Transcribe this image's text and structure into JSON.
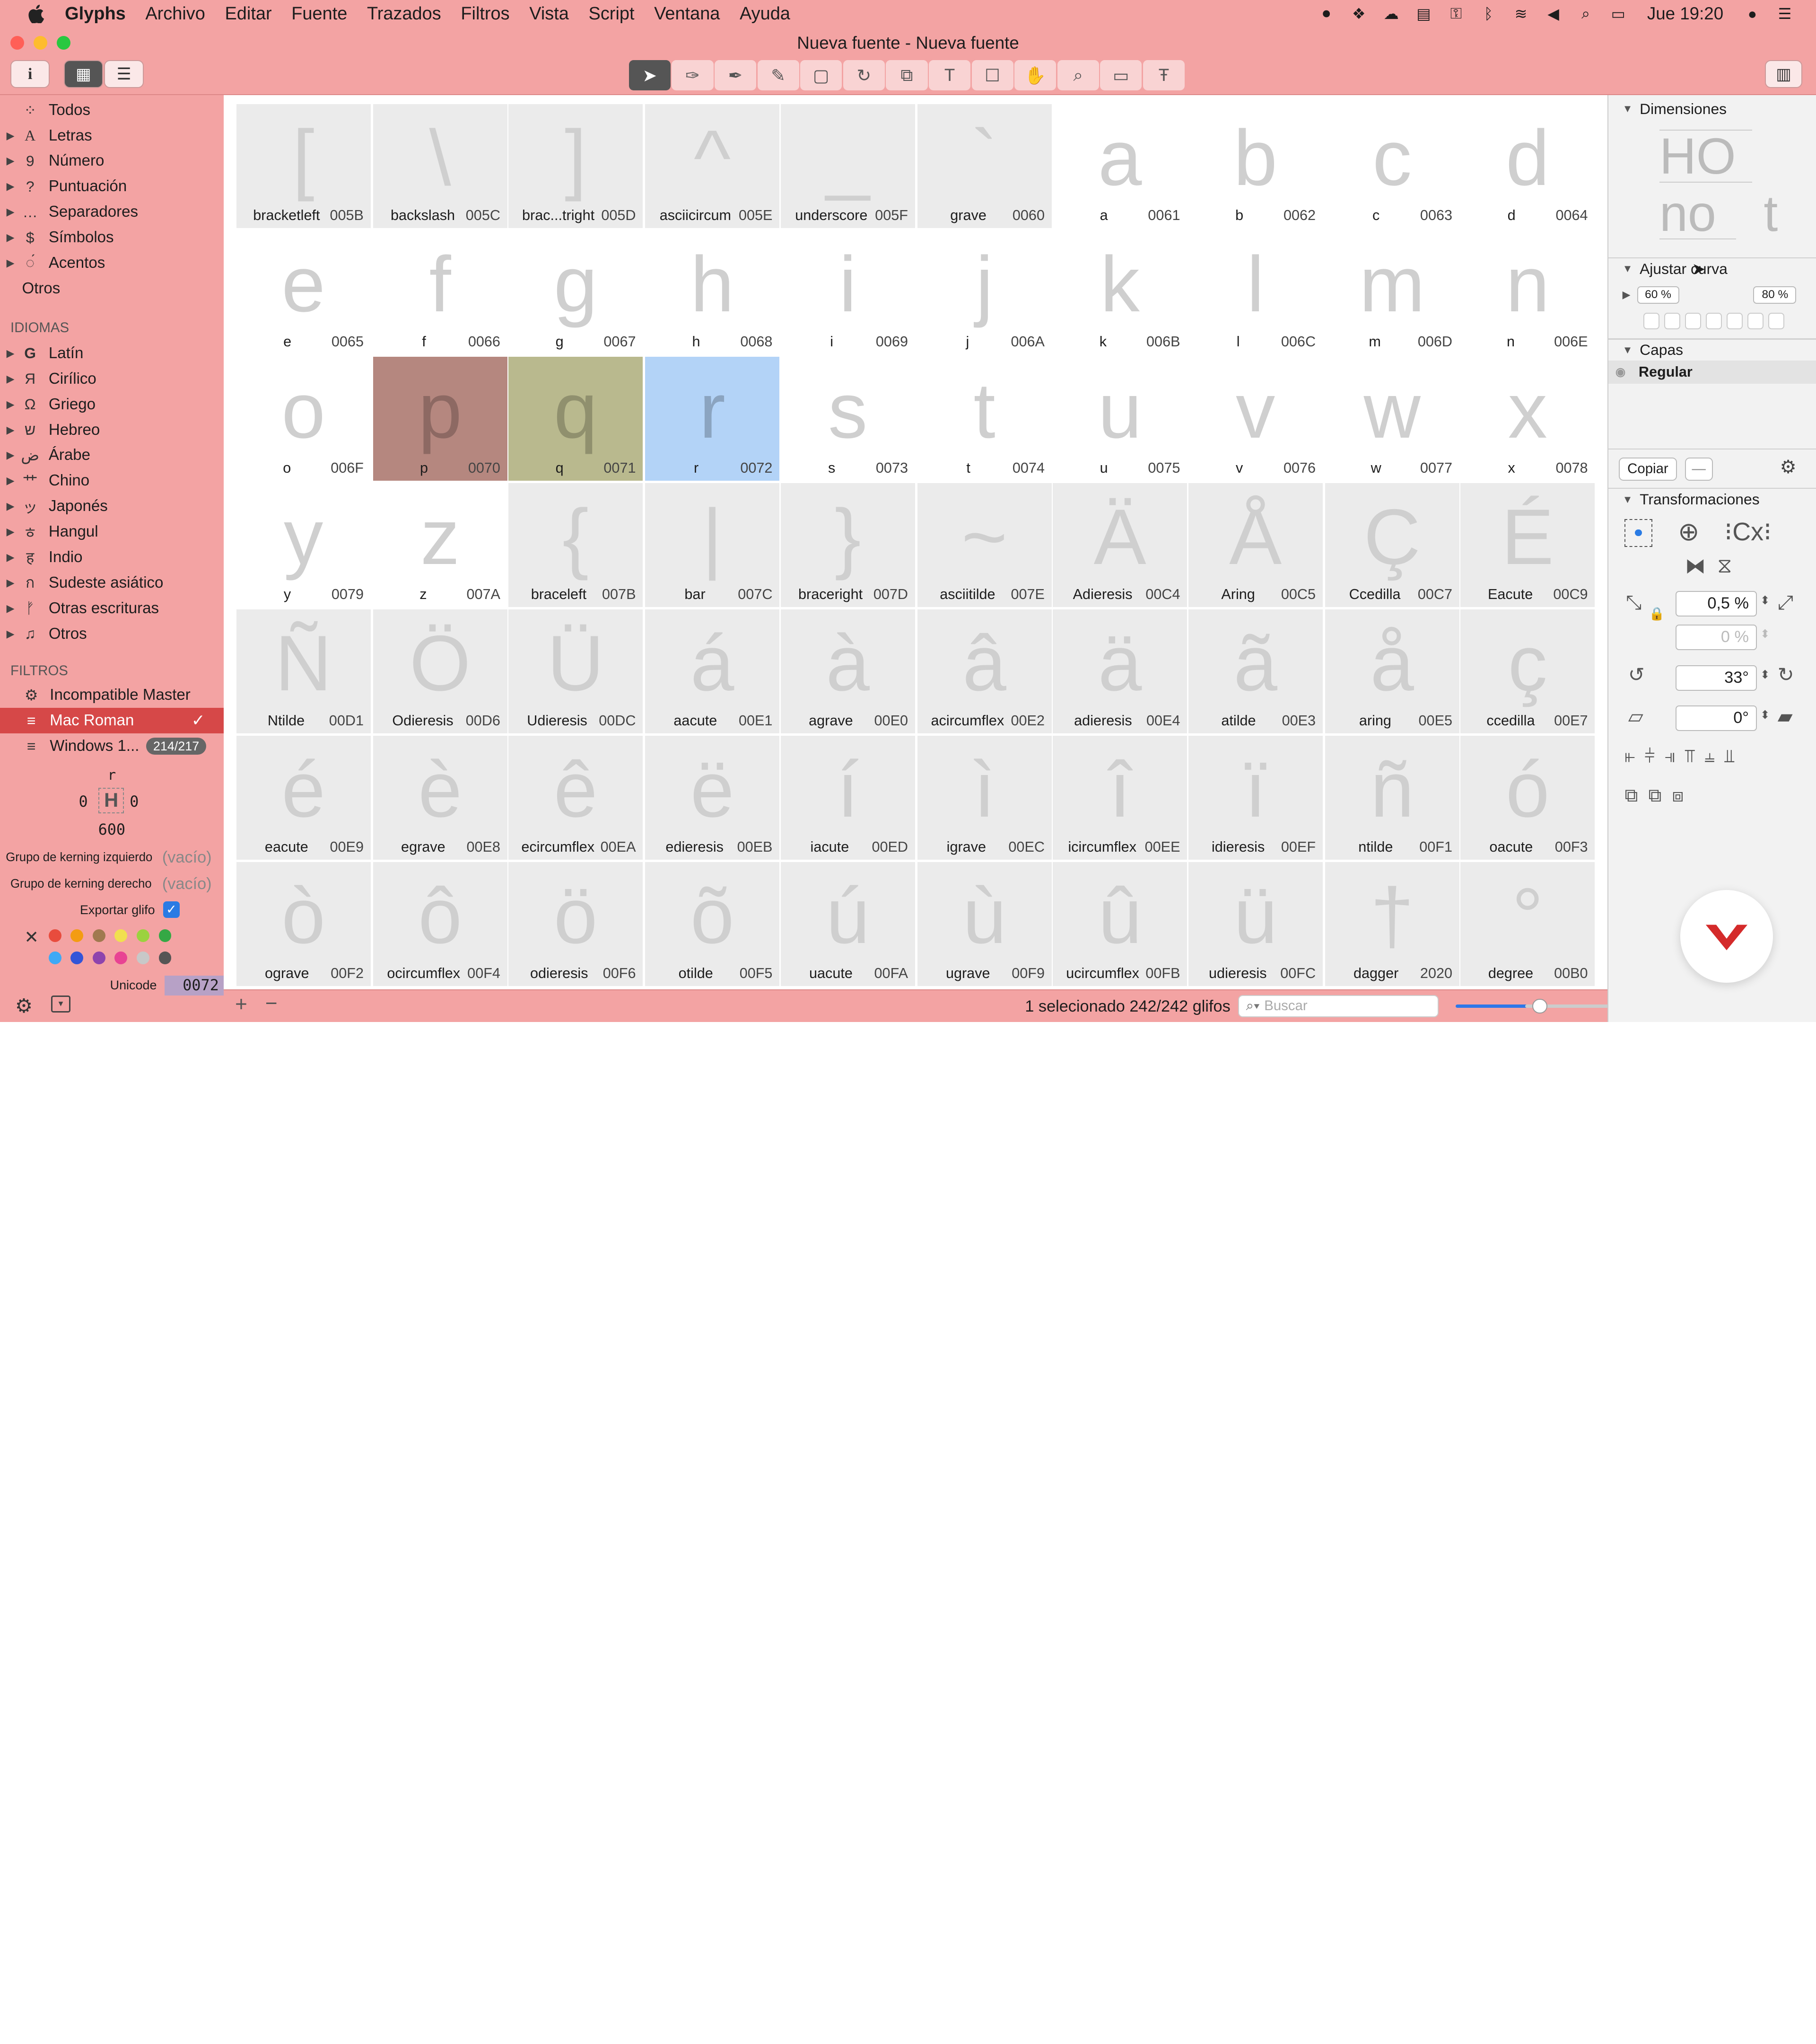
{
  "menubar": {
    "app": "Glyphs",
    "items": [
      "Archivo",
      "Editar",
      "Fuente",
      "Trazados",
      "Filtros",
      "Vista",
      "Script",
      "Ventana",
      "Ayuda"
    ],
    "clock": "Jue 19:20"
  },
  "window": {
    "title": "Nueva fuente - Nueva fuente"
  },
  "sidebar": {
    "categories": [
      {
        "label": "Todos",
        "icon": "grid-icon"
      },
      {
        "label": "Letras",
        "icon": "letter-icon"
      },
      {
        "label": "Número",
        "icon": "number-icon"
      },
      {
        "label": "Puntuación",
        "icon": "question-icon"
      },
      {
        "label": "Separadores",
        "icon": "dots-icon"
      },
      {
        "label": "Símbolos",
        "icon": "dollar-icon"
      },
      {
        "label": "Acentos",
        "icon": "accent-icon"
      },
      {
        "label": "Otros",
        "icon": ""
      }
    ],
    "idiomas_header": "IDIOMAS",
    "languages": [
      "Latín",
      "Cirílico",
      "Griego",
      "Hebreo",
      "Árabe",
      "Chino",
      "Japonés",
      "Hangul",
      "Indio",
      "Sudeste asiático",
      "Otras escrituras",
      "Otros"
    ],
    "filtros_header": "FILTROS",
    "filters": [
      {
        "label": "Incompatible Master"
      },
      {
        "label": "Mac Roman",
        "selected": true
      },
      {
        "label": "Windows 1...",
        "badge": "214/217"
      }
    ],
    "glyph_info": {
      "name": "r",
      "lsb": "0",
      "rsb": "0",
      "width": "600"
    },
    "kern_left_label": "Grupo de kerning izquierdo",
    "kern_left_value": "(vacío)",
    "kern_right_label": "Grupo de kerning derecho",
    "kern_right_value": "(vacío)",
    "export_label": "Exportar glifo",
    "unicode_label": "Unicode",
    "unicode_value": "0072"
  },
  "glyphs": [
    {
      "ch": "[",
      "name": "bracketleft",
      "code": "005B",
      "bg": true
    },
    {
      "ch": "\\",
      "name": "backslash",
      "code": "005C",
      "bg": true
    },
    {
      "ch": "]",
      "name": "brac...tright",
      "code": "005D",
      "bg": true
    },
    {
      "ch": "^",
      "name": "asciicircum",
      "code": "005E",
      "bg": true
    },
    {
      "ch": "_",
      "name": "underscore",
      "code": "005F",
      "bg": true
    },
    {
      "ch": "`",
      "name": "grave",
      "code": "0060",
      "bg": true
    },
    {
      "ch": "a",
      "name": "a",
      "code": "0061"
    },
    {
      "ch": "b",
      "name": "b",
      "code": "0062"
    },
    {
      "ch": "c",
      "name": "c",
      "code": "0063"
    },
    {
      "ch": "d",
      "name": "d",
      "code": "0064"
    },
    {
      "ch": "e",
      "name": "e",
      "code": "0065"
    },
    {
      "ch": "f",
      "name": "f",
      "code": "0066"
    },
    {
      "ch": "g",
      "name": "g",
      "code": "0067"
    },
    {
      "ch": "h",
      "name": "h",
      "code": "0068"
    },
    {
      "ch": "i",
      "name": "i",
      "code": "0069"
    },
    {
      "ch": "j",
      "name": "j",
      "code": "006A"
    },
    {
      "ch": "k",
      "name": "k",
      "code": "006B"
    },
    {
      "ch": "l",
      "name": "l",
      "code": "006C"
    },
    {
      "ch": "m",
      "name": "m",
      "code": "006D"
    },
    {
      "ch": "n",
      "name": "n",
      "code": "006E"
    },
    {
      "ch": "o",
      "name": "o",
      "code": "006F"
    },
    {
      "ch": "p",
      "name": "p",
      "code": "0070",
      "color": "#b5877f"
    },
    {
      "ch": "q",
      "name": "q",
      "code": "0071",
      "color": "#b9b98e"
    },
    {
      "ch": "r",
      "name": "r",
      "code": "0072",
      "color": "#b3d3f7",
      "selected": true
    },
    {
      "ch": "s",
      "name": "s",
      "code": "0073"
    },
    {
      "ch": "t",
      "name": "t",
      "code": "0074"
    },
    {
      "ch": "u",
      "name": "u",
      "code": "0075"
    },
    {
      "ch": "v",
      "name": "v",
      "code": "0076"
    },
    {
      "ch": "w",
      "name": "w",
      "code": "0077"
    },
    {
      "ch": "x",
      "name": "x",
      "code": "0078"
    },
    {
      "ch": "y",
      "name": "y",
      "code": "0079"
    },
    {
      "ch": "z",
      "name": "z",
      "code": "007A"
    },
    {
      "ch": "{",
      "name": "braceleft",
      "code": "007B",
      "bg": true
    },
    {
      "ch": "|",
      "name": "bar",
      "code": "007C",
      "bg": true
    },
    {
      "ch": "}",
      "name": "braceright",
      "code": "007D",
      "bg": true
    },
    {
      "ch": "~",
      "name": "asciitilde",
      "code": "007E",
      "bg": true
    },
    {
      "ch": "Ä",
      "name": "Adieresis",
      "code": "00C4",
      "bg": true
    },
    {
      "ch": "Å",
      "name": "Aring",
      "code": "00C5",
      "bg": true
    },
    {
      "ch": "Ç",
      "name": "Ccedilla",
      "code": "00C7",
      "bg": true
    },
    {
      "ch": "É",
      "name": "Eacute",
      "code": "00C9",
      "bg": true
    },
    {
      "ch": "Ñ",
      "name": "Ntilde",
      "code": "00D1",
      "bg": true
    },
    {
      "ch": "Ö",
      "name": "Odieresis",
      "code": "00D6",
      "bg": true
    },
    {
      "ch": "Ü",
      "name": "Udieresis",
      "code": "00DC",
      "bg": true
    },
    {
      "ch": "á",
      "name": "aacute",
      "code": "00E1",
      "bg": true
    },
    {
      "ch": "à",
      "name": "agrave",
      "code": "00E0",
      "bg": true
    },
    {
      "ch": "â",
      "name": "acircumflex",
      "code": "00E2",
      "bg": true
    },
    {
      "ch": "ä",
      "name": "adieresis",
      "code": "00E4",
      "bg": true
    },
    {
      "ch": "ã",
      "name": "atilde",
      "code": "00E3",
      "bg": true
    },
    {
      "ch": "å",
      "name": "aring",
      "code": "00E5",
      "bg": true
    },
    {
      "ch": "ç",
      "name": "ccedilla",
      "code": "00E7",
      "bg": true
    },
    {
      "ch": "é",
      "name": "eacute",
      "code": "00E9",
      "bg": true
    },
    {
      "ch": "è",
      "name": "egrave",
      "code": "00E8",
      "bg": true
    },
    {
      "ch": "ê",
      "name": "ecircumflex",
      "code": "00EA",
      "bg": true
    },
    {
      "ch": "ë",
      "name": "edieresis",
      "code": "00EB",
      "bg": true
    },
    {
      "ch": "í",
      "name": "iacute",
      "code": "00ED",
      "bg": true
    },
    {
      "ch": "ì",
      "name": "igrave",
      "code": "00EC",
      "bg": true
    },
    {
      "ch": "î",
      "name": "icircumflex",
      "code": "00EE",
      "bg": true
    },
    {
      "ch": "ï",
      "name": "idieresis",
      "code": "00EF",
      "bg": true
    },
    {
      "ch": "ñ",
      "name": "ntilde",
      "code": "00F1",
      "bg": true
    },
    {
      "ch": "ó",
      "name": "oacute",
      "code": "00F3",
      "bg": true
    },
    {
      "ch": "ò",
      "name": "ograve",
      "code": "00F2",
      "bg": true
    },
    {
      "ch": "ô",
      "name": "ocircumflex",
      "code": "00F4",
      "bg": true
    },
    {
      "ch": "ö",
      "name": "odieresis",
      "code": "00F6",
      "bg": true
    },
    {
      "ch": "õ",
      "name": "otilde",
      "code": "00F5",
      "bg": true
    },
    {
      "ch": "ú",
      "name": "uacute",
      "code": "00FA",
      "bg": true
    },
    {
      "ch": "ù",
      "name": "ugrave",
      "code": "00F9",
      "bg": true
    },
    {
      "ch": "û",
      "name": "ucircumflex",
      "code": "00FB",
      "bg": true
    },
    {
      "ch": "ü",
      "name": "udieresis",
      "code": "00FC",
      "bg": true
    },
    {
      "ch": "†",
      "name": "dagger",
      "code": "2020",
      "bg": true
    },
    {
      "ch": "°",
      "name": "degree",
      "code": "00B0",
      "bg": true
    }
  ],
  "status": {
    "selection": "1 selecionado 242/242 glifos",
    "search_placeholder": "Buscar"
  },
  "right_panel": {
    "dimensions_header": "Dimensiones",
    "dimensions_preview_top": "HO",
    "dimensions_preview_bottom": "no",
    "dimensions_preview_t": "t",
    "curve_header": "Ajustar curva",
    "curve_min": "60 %",
    "curve_max": "80 %",
    "layers_header": "Capas",
    "layer_name": "Regular",
    "copy_label": "Copiar",
    "minus_label": "—",
    "transform_header": "Transformaciones",
    "scale_value": "0,5 %",
    "scale2_value": "0 %",
    "rotate_value": "33°",
    "slant_value": "0°"
  },
  "colors": {
    "window_tint": "#f3a3a3",
    "selection": "#d64848",
    "selected_cell": "#b3d3f7"
  }
}
